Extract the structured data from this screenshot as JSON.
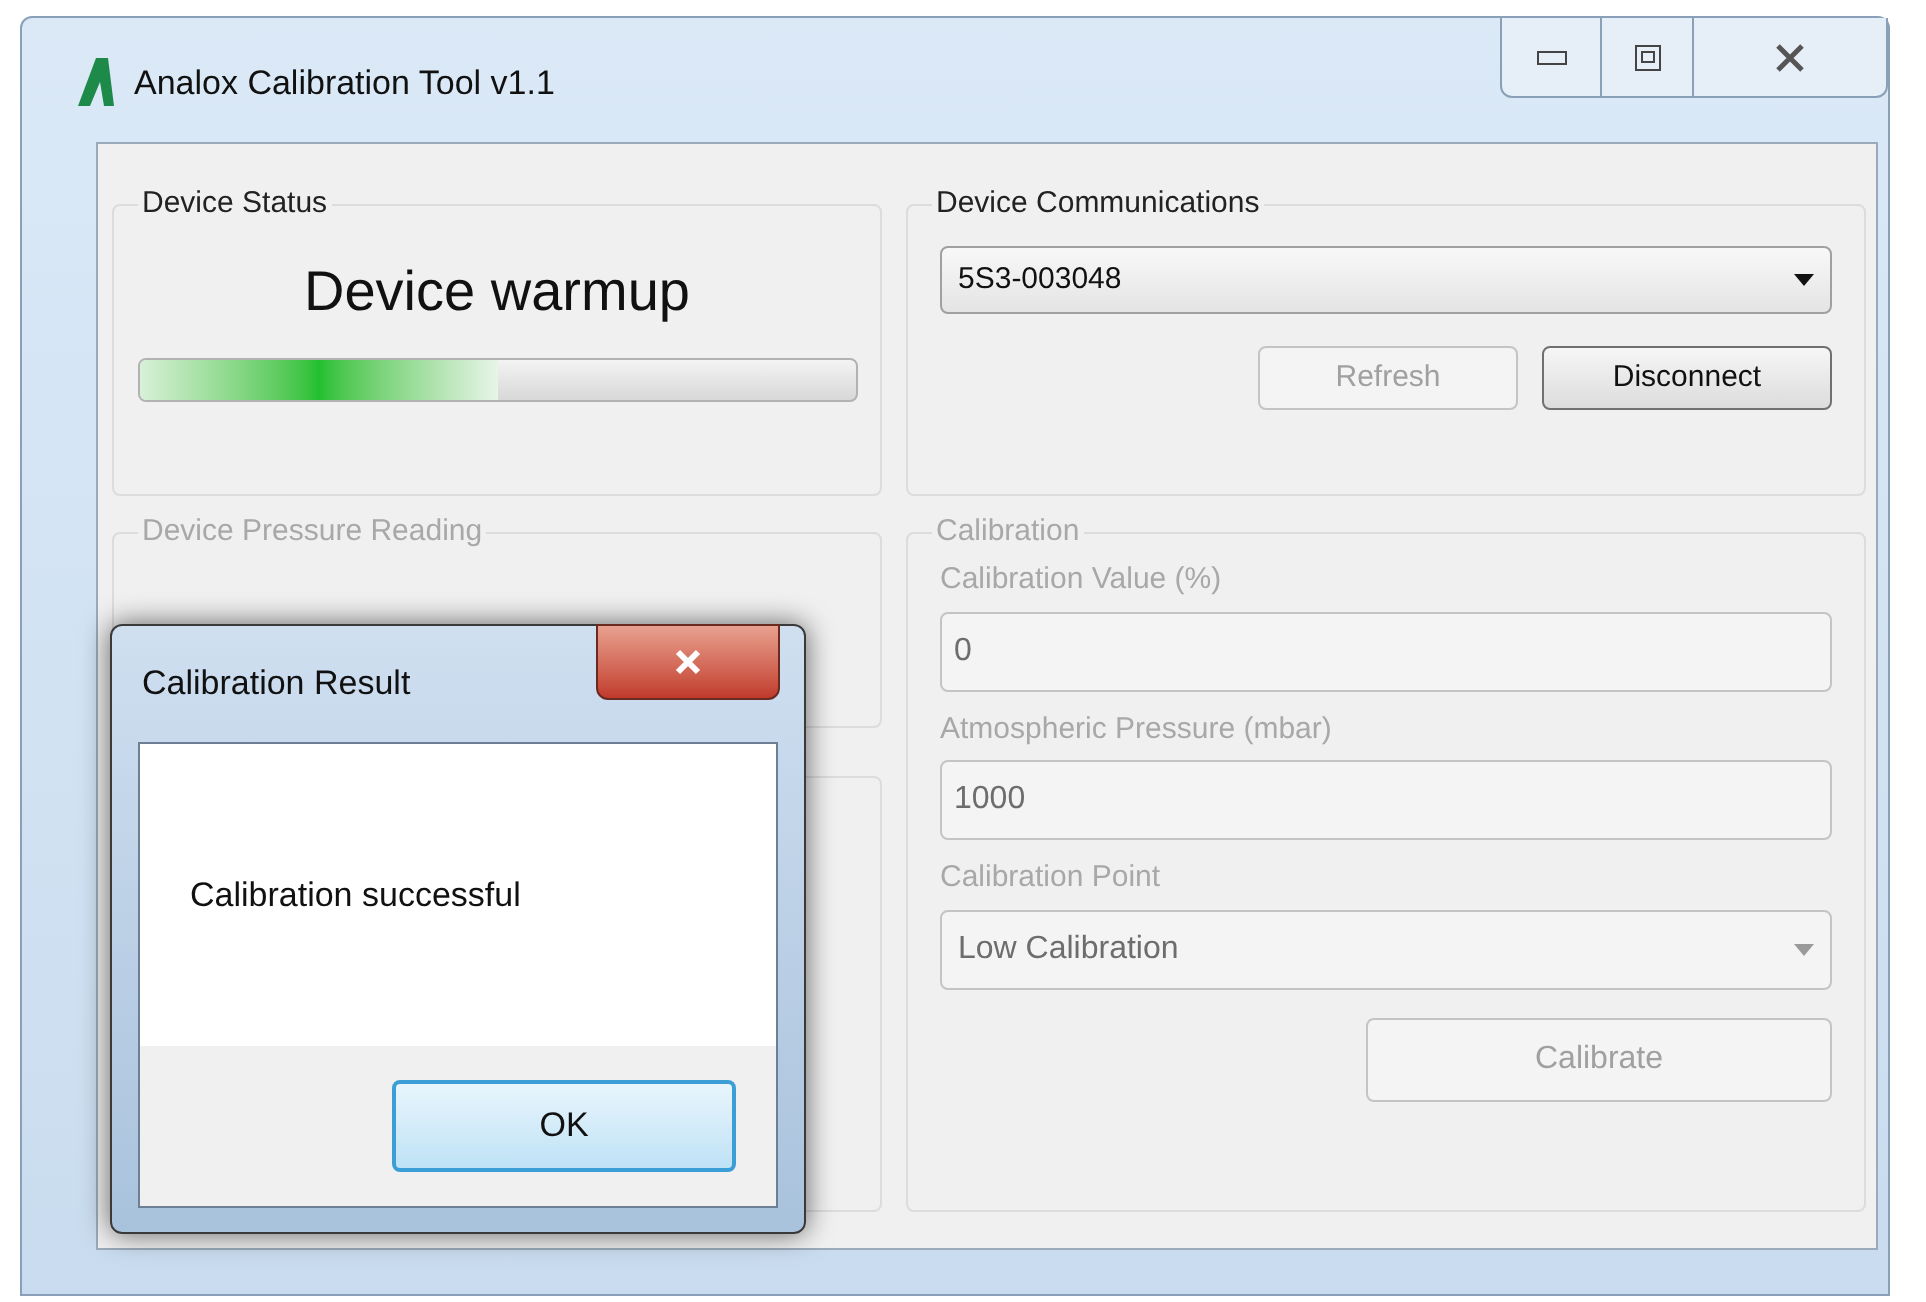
{
  "window": {
    "title": "Analox Calibration Tool v1.1"
  },
  "device_status": {
    "title": "Device Status",
    "status": "Device warmup",
    "progress": {
      "level": 0.5
    }
  },
  "device_communications": {
    "title": "Device Communications",
    "device": "5S3-003048",
    "buttons": [
      {
        "label": "Refresh",
        "disabled": true
      },
      {
        "label": "Disconnect",
        "disabled": false
      }
    ]
  },
  "device_pressure_reading": {
    "title": "Device Pressure Reading",
    "disabled": true
  },
  "calibration": {
    "title": "Calibration",
    "disabled": true,
    "fields": [
      {
        "kind": "text",
        "label": "Calibration Value (%)",
        "value": "0"
      },
      {
        "kind": "text",
        "label": "Atmospheric Pressure (mbar)",
        "value": "1000"
      },
      {
        "kind": "select",
        "label": "Calibration Point",
        "value": "Low Calibration"
      }
    ],
    "button": {
      "label": "Calibrate",
      "disabled": true
    }
  },
  "dialog": {
    "title": "Calibration Result",
    "message": "Calibration successful",
    "button": "OK"
  }
}
